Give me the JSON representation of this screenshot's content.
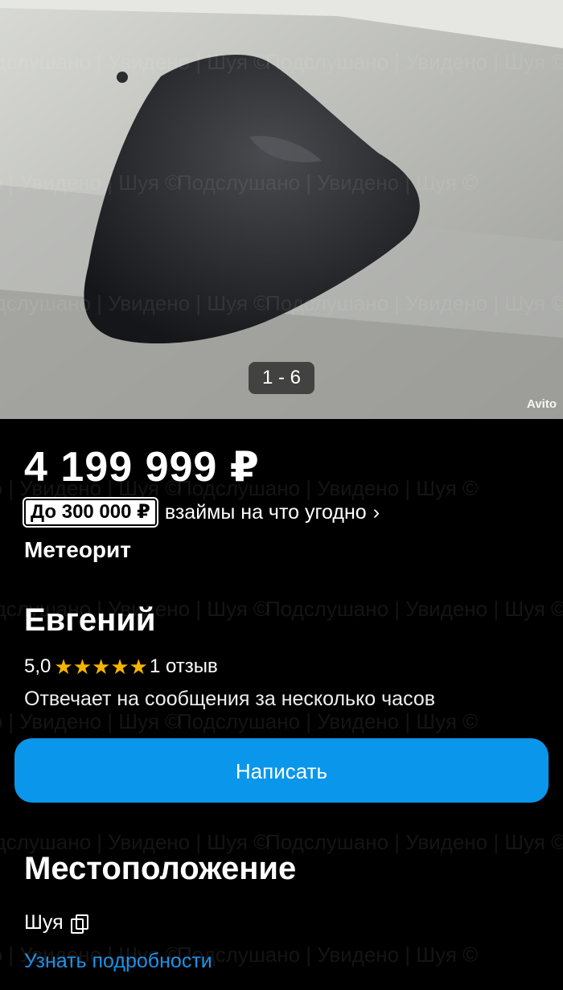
{
  "photo": {
    "counter": "1 - 6",
    "source_mark": "Avito"
  },
  "listing": {
    "price": "4 199 999 ₽",
    "loan_badge": "До 300 000 ₽",
    "loan_text": "взаймы на что угодно",
    "title": "Метеорит"
  },
  "seller": {
    "name": "Евгений",
    "rating": "5,0",
    "stars": 5,
    "reviews": "1 отзыв",
    "reply_time": "Отвечает на сообщения за несколько часов"
  },
  "actions": {
    "write_button": "Написать"
  },
  "location": {
    "heading": "Местоположение",
    "city": "Шуя",
    "details_link": "Узнать подробности"
  },
  "watermark": {
    "text": "Подслушано | Увидено | Шуя ©"
  },
  "colors": {
    "accent": "#0a96ea",
    "link": "#1a8fe6",
    "star": "#f4b400",
    "background": "#000000"
  }
}
